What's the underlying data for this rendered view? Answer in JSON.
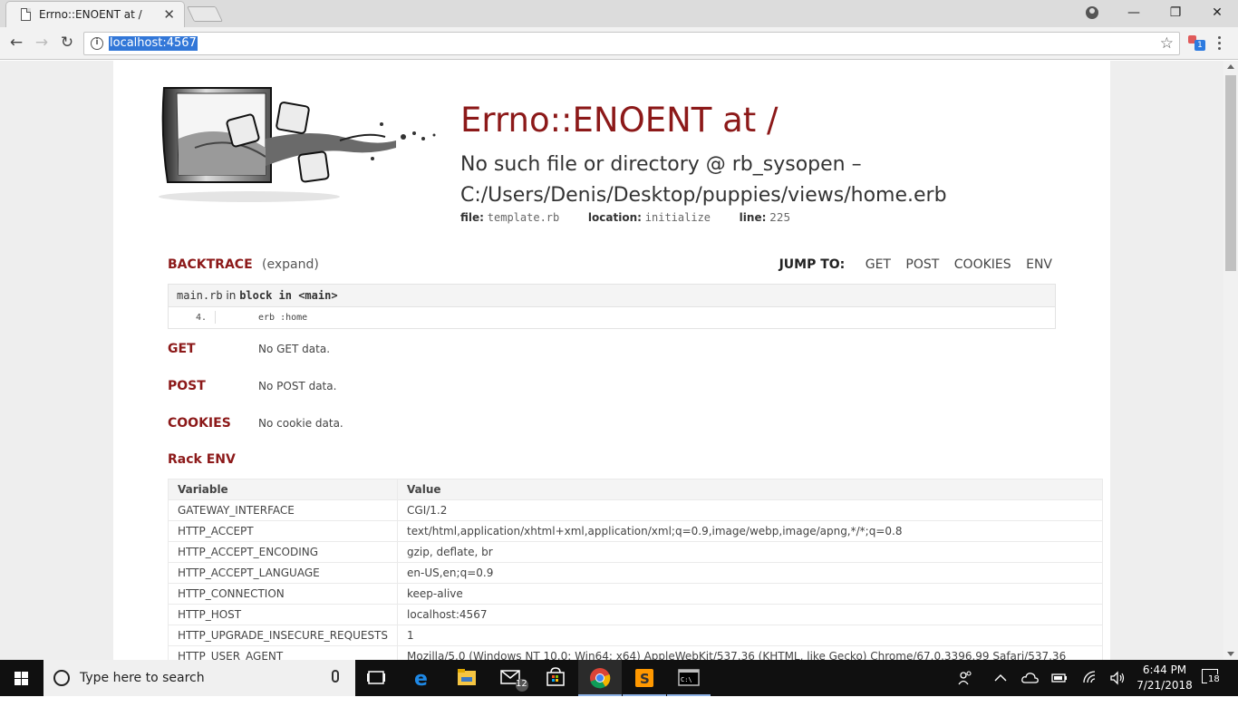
{
  "browser": {
    "tab_title": "Errno::ENOENT at /",
    "tab_close": "✕",
    "url": "localhost:4567",
    "extension_badge": "1",
    "window_controls": {
      "minimize": "—",
      "restore": "❐",
      "close": "✕"
    }
  },
  "error": {
    "title": "Errno::ENOENT at /",
    "message": "No such file or directory @ rb_sysopen – C:/Users/Denis/Desktop/puppies/views/home.erb",
    "file_label": "file:",
    "file_value": "template.rb",
    "location_label": "location:",
    "location_value": "initialize",
    "line_label": "line:",
    "line_value": "225"
  },
  "backtrace": {
    "label": "BACKTRACE",
    "expand": "(expand)",
    "jump_label": "JUMP TO:",
    "jump_links": [
      "GET",
      "POST",
      "COOKIES",
      "ENV"
    ],
    "frame_file": "main.rb",
    "frame_in": "in",
    "frame_context": "block in <main>",
    "line_number": "4.",
    "line_code": "erb :home"
  },
  "get": {
    "label": "GET",
    "text": "No GET data."
  },
  "post": {
    "label": "POST",
    "text": "No POST data."
  },
  "cookies": {
    "label": "COOKIES",
    "text": "No cookie data."
  },
  "rack_env": {
    "label": "Rack ENV",
    "headers": [
      "Variable",
      "Value"
    ],
    "rows": [
      [
        "GATEWAY_INTERFACE",
        "CGI/1.2"
      ],
      [
        "HTTP_ACCEPT",
        "text/html,application/xhtml+xml,application/xml;q=0.9,image/webp,image/apng,*/*;q=0.8"
      ],
      [
        "HTTP_ACCEPT_ENCODING",
        "gzip, deflate, br"
      ],
      [
        "HTTP_ACCEPT_LANGUAGE",
        "en-US,en;q=0.9"
      ],
      [
        "HTTP_CONNECTION",
        "keep-alive"
      ],
      [
        "HTTP_HOST",
        "localhost:4567"
      ],
      [
        "HTTP_UPGRADE_INSECURE_REQUESTS",
        "1"
      ],
      [
        "HTTP_USER_AGENT",
        "Mozilla/5.0 (Windows NT 10.0; Win64; x64) AppleWebKit/537.36 (KHTML, like Gecko) Chrome/67.0.3396.99 Safari/537.36"
      ]
    ]
  },
  "taskbar": {
    "search_placeholder": "Type here to search",
    "mail_badge": "12",
    "time": "6:44 PM",
    "date": "7/21/2018",
    "notification_count": "18"
  },
  "colors": {
    "accent_red": "#8c1919",
    "url_highlight": "#3277d8"
  }
}
